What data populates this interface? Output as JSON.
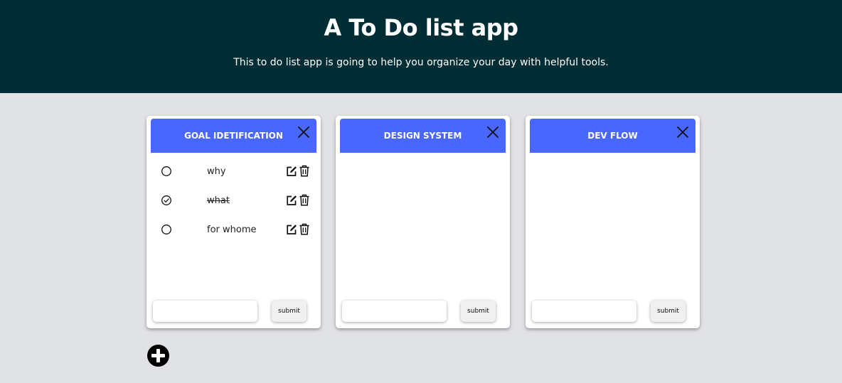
{
  "header": {
    "title": "A To Do list app",
    "subtitle": "This to do list app is going to help you organize your day with helpful tools."
  },
  "lists": [
    {
      "title": "GOAL IDETIFICATION",
      "todos": [
        {
          "text": "why",
          "done": false
        },
        {
          "text": "what",
          "done": true
        },
        {
          "text": "for whome",
          "done": false
        }
      ],
      "input_value": "",
      "submit_label": "submit"
    },
    {
      "title": "DESIGN SYSTEM",
      "todos": [],
      "input_value": "",
      "submit_label": "submit"
    },
    {
      "title": "DEV FLOW",
      "todos": [],
      "input_value": "",
      "submit_label": "submit"
    }
  ],
  "icons": {
    "close": "close-icon",
    "unchecked": "circle-icon",
    "checked": "check-circle-icon",
    "edit": "edit-icon",
    "delete": "trash-icon",
    "add_list": "plus-circle-icon"
  },
  "colors": {
    "header_bg": "#012d35",
    "page_bg": "#e1e2e6",
    "card_header_bg": "#4966fe"
  }
}
